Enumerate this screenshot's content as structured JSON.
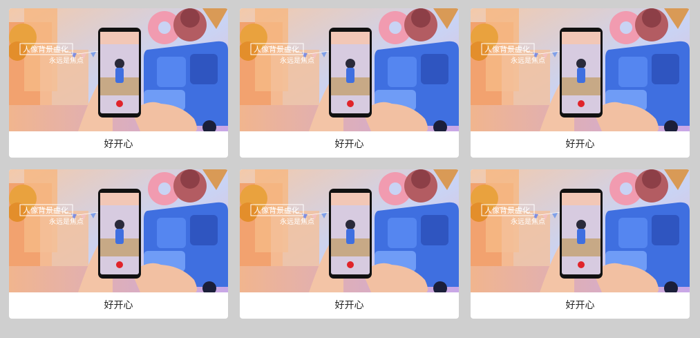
{
  "cards": [
    {
      "title": "好开心",
      "thumb_text_1": "人像背景虚化",
      "thumb_text_2": "永远是焦点"
    },
    {
      "title": "好开心",
      "thumb_text_1": "人像背景虚化",
      "thumb_text_2": "永远是焦点"
    },
    {
      "title": "好开心",
      "thumb_text_1": "人像背景虚化",
      "thumb_text_2": "永远是焦点"
    },
    {
      "title": "好开心",
      "thumb_text_1": "人像背景虚化",
      "thumb_text_2": "永远是焦点"
    },
    {
      "title": "好开心",
      "thumb_text_1": "人像背景虚化",
      "thumb_text_2": "永远是焦点"
    },
    {
      "title": "好开心",
      "thumb_text_1": "人像背景虚化",
      "thumb_text_2": "永远是焦点"
    }
  ],
  "colors": {
    "page_background": "#cfcfcf",
    "card_background": "#ffffff",
    "truck_blue": "#3f6fe0",
    "record_red": "#e0242a"
  }
}
